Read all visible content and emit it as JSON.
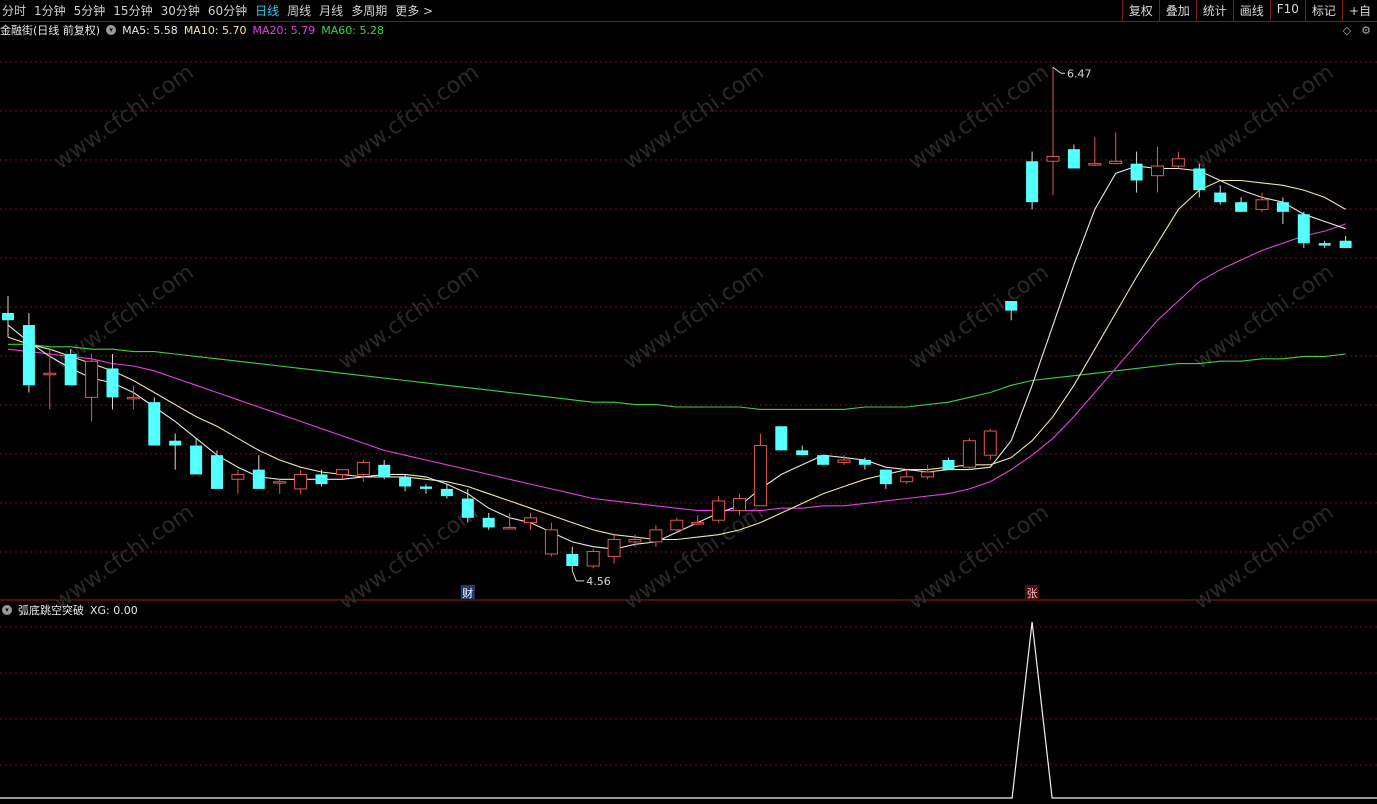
{
  "toolbar": {
    "periods": [
      "分时",
      "1分钟",
      "5分钟",
      "15分钟",
      "30分钟",
      "60分钟",
      "日线",
      "周线",
      "月线",
      "多周期",
      "更多 >"
    ],
    "active_period": "日线",
    "right_tools": [
      "复权",
      "叠加",
      "统计",
      "画线",
      "F10",
      "标记",
      "+自"
    ]
  },
  "stock": {
    "title": "金融街(日线 前复权)",
    "ma": [
      {
        "label": "MA5: 5.58",
        "color": "#e8e8e8"
      },
      {
        "label": "MA10: 5.70",
        "color": "#f0e6a0"
      },
      {
        "label": "MA20: 5.79",
        "color": "#e040e0"
      },
      {
        "label": "MA60: 5.28",
        "color": "#40d040"
      }
    ]
  },
  "indicator": {
    "title": "弧底跳空突破",
    "value": "XG: 0.00"
  },
  "annotations": {
    "high": "6.47",
    "low": "4.56",
    "marker1": "财",
    "marker2": "张"
  },
  "corner": {
    "diamond": "◇",
    "gear": "⚙"
  },
  "watermark": "www.cfchi.com",
  "colors": {
    "up": "#e05a4a",
    "down": "#54ffff",
    "ma5": "#e8e8e8",
    "ma10": "#f0e6a0",
    "ma20": "#e040e0",
    "ma60": "#40d040",
    "grid": "#6a1818"
  },
  "chart_data": {
    "type": "candlestick",
    "price_range": [
      4.4,
      6.55
    ],
    "candles": [
      {
        "o": 5.45,
        "h": 5.52,
        "l": 5.35,
        "c": 5.42
      },
      {
        "o": 5.4,
        "h": 5.45,
        "l": 5.12,
        "c": 5.15
      },
      {
        "o": 5.2,
        "h": 5.3,
        "l": 5.05,
        "c": 5.2
      },
      {
        "o": 5.28,
        "h": 5.3,
        "l": 5.15,
        "c": 5.15
      },
      {
        "o": 5.1,
        "h": 5.28,
        "l": 5.0,
        "c": 5.25
      },
      {
        "o": 5.22,
        "h": 5.28,
        "l": 5.05,
        "c": 5.1
      },
      {
        "o": 5.1,
        "h": 5.15,
        "l": 5.05,
        "c": 5.1
      },
      {
        "o": 5.08,
        "h": 5.1,
        "l": 4.9,
        "c": 4.9
      },
      {
        "o": 4.92,
        "h": 4.95,
        "l": 4.8,
        "c": 4.9
      },
      {
        "o": 4.9,
        "h": 4.93,
        "l": 4.78,
        "c": 4.78
      },
      {
        "o": 4.86,
        "h": 4.88,
        "l": 4.72,
        "c": 4.72
      },
      {
        "o": 4.76,
        "h": 4.8,
        "l": 4.7,
        "c": 4.78
      },
      {
        "o": 4.8,
        "h": 4.86,
        "l": 4.72,
        "c": 4.72
      },
      {
        "o": 4.75,
        "h": 4.76,
        "l": 4.7,
        "c": 4.75
      },
      {
        "o": 4.72,
        "h": 4.8,
        "l": 4.7,
        "c": 4.78
      },
      {
        "o": 4.78,
        "h": 4.8,
        "l": 4.73,
        "c": 4.74
      },
      {
        "o": 4.78,
        "h": 4.8,
        "l": 4.76,
        "c": 4.8
      },
      {
        "o": 4.78,
        "h": 4.84,
        "l": 4.75,
        "c": 4.83
      },
      {
        "o": 4.82,
        "h": 4.84,
        "l": 4.76,
        "c": 4.77
      },
      {
        "o": 4.77,
        "h": 4.78,
        "l": 4.71,
        "c": 4.73
      },
      {
        "o": 4.73,
        "h": 4.74,
        "l": 4.7,
        "c": 4.72
      },
      {
        "o": 4.72,
        "h": 4.74,
        "l": 4.68,
        "c": 4.69
      },
      {
        "o": 4.68,
        "h": 4.72,
        "l": 4.58,
        "c": 4.6
      },
      {
        "o": 4.6,
        "h": 4.62,
        "l": 4.55,
        "c": 4.56
      },
      {
        "o": 4.56,
        "h": 4.62,
        "l": 4.56,
        "c": 4.56
      },
      {
        "o": 4.58,
        "h": 4.62,
        "l": 4.55,
        "c": 4.6
      },
      {
        "o": 4.45,
        "h": 4.58,
        "l": 4.44,
        "c": 4.55
      },
      {
        "o": 4.45,
        "h": 4.48,
        "l": 4.38,
        "c": 4.4
      },
      {
        "o": 4.4,
        "h": 4.47,
        "l": 4.39,
        "c": 4.46
      },
      {
        "o": 4.44,
        "h": 4.53,
        "l": 4.41,
        "c": 4.51
      },
      {
        "o": 4.5,
        "h": 4.53,
        "l": 4.48,
        "c": 4.51
      },
      {
        "o": 4.5,
        "h": 4.57,
        "l": 4.48,
        "c": 4.55
      },
      {
        "o": 4.55,
        "h": 4.6,
        "l": 4.54,
        "c": 4.59
      },
      {
        "o": 4.58,
        "h": 4.61,
        "l": 4.57,
        "c": 4.58
      },
      {
        "o": 4.59,
        "h": 4.69,
        "l": 4.58,
        "c": 4.67
      },
      {
        "o": 4.63,
        "h": 4.7,
        "l": 4.61,
        "c": 4.68
      },
      {
        "o": 4.65,
        "h": 4.95,
        "l": 4.65,
        "c": 4.9
      },
      {
        "o": 4.98,
        "h": 4.98,
        "l": 4.88,
        "c": 4.88
      },
      {
        "o": 4.88,
        "h": 4.9,
        "l": 4.86,
        "c": 4.86
      },
      {
        "o": 4.86,
        "h": 4.86,
        "l": 4.82,
        "c": 4.82
      },
      {
        "o": 4.83,
        "h": 4.86,
        "l": 4.82,
        "c": 4.84
      },
      {
        "o": 4.84,
        "h": 4.85,
        "l": 4.8,
        "c": 4.82
      },
      {
        "o": 4.8,
        "h": 4.8,
        "l": 4.72,
        "c": 4.74
      },
      {
        "o": 4.75,
        "h": 4.8,
        "l": 4.74,
        "c": 4.77
      },
      {
        "o": 4.77,
        "h": 4.82,
        "l": 4.76,
        "c": 4.79
      },
      {
        "o": 4.84,
        "h": 4.85,
        "l": 4.8,
        "c": 4.8
      },
      {
        "o": 4.81,
        "h": 4.93,
        "l": 4.8,
        "c": 4.92
      },
      {
        "o": 4.86,
        "h": 4.97,
        "l": 4.84,
        "c": 4.96
      },
      {
        "o": 5.5,
        "h": 5.5,
        "l": 5.42,
        "c": 5.46
      },
      {
        "o": 6.08,
        "h": 6.12,
        "l": 5.88,
        "c": 5.91
      },
      {
        "o": 6.08,
        "h": 6.47,
        "l": 5.94,
        "c": 6.1
      },
      {
        "o": 6.13,
        "h": 6.15,
        "l": 6.05,
        "c": 6.05
      },
      {
        "o": 6.07,
        "h": 6.18,
        "l": 6.06,
        "c": 6.07
      },
      {
        "o": 6.07,
        "h": 6.2,
        "l": 6.07,
        "c": 6.08
      },
      {
        "o": 6.07,
        "h": 6.12,
        "l": 5.95,
        "c": 6.0
      },
      {
        "o": 6.02,
        "h": 6.14,
        "l": 5.95,
        "c": 6.06
      },
      {
        "o": 6.06,
        "h": 6.12,
        "l": 6.05,
        "c": 6.09
      },
      {
        "o": 6.05,
        "h": 6.07,
        "l": 5.93,
        "c": 5.96
      },
      {
        "o": 5.95,
        "h": 5.98,
        "l": 5.9,
        "c": 5.91
      },
      {
        "o": 5.91,
        "h": 5.93,
        "l": 5.87,
        "c": 5.87
      },
      {
        "o": 5.88,
        "h": 5.95,
        "l": 5.87,
        "c": 5.92
      },
      {
        "o": 5.91,
        "h": 5.93,
        "l": 5.82,
        "c": 5.87
      },
      {
        "o": 5.86,
        "h": 5.87,
        "l": 5.72,
        "c": 5.74
      },
      {
        "o": 5.74,
        "h": 5.75,
        "l": 5.72,
        "c": 5.73
      },
      {
        "o": 5.75,
        "h": 5.77,
        "l": 5.72,
        "c": 5.72
      }
    ],
    "ma5": [
      5.4,
      5.33,
      5.27,
      5.22,
      5.18,
      5.16,
      5.12,
      5.06,
      5.0,
      4.93,
      4.86,
      4.81,
      4.77,
      4.76,
      4.76,
      4.76,
      4.76,
      4.77,
      4.78,
      4.78,
      4.77,
      4.74,
      4.7,
      4.64,
      4.6,
      4.58,
      4.54,
      4.5,
      4.48,
      4.47,
      4.49,
      4.5,
      4.54,
      4.58,
      4.62,
      4.65,
      4.72,
      4.78,
      4.82,
      4.86,
      4.85,
      4.84,
      4.81,
      4.8,
      4.79,
      4.8,
      4.8,
      4.81,
      4.92,
      5.15,
      5.4,
      5.65,
      5.88,
      6.03,
      6.06,
      6.05,
      6.05,
      6.04,
      6.0,
      5.96,
      5.93,
      5.91,
      5.86,
      5.83,
      5.8
    ],
    "ma10": [
      5.35,
      5.32,
      5.3,
      5.27,
      5.24,
      5.21,
      5.17,
      5.12,
      5.07,
      5.02,
      4.98,
      4.93,
      4.88,
      4.84,
      4.81,
      4.79,
      4.78,
      4.77,
      4.77,
      4.77,
      4.76,
      4.75,
      4.73,
      4.7,
      4.67,
      4.64,
      4.61,
      4.58,
      4.55,
      4.53,
      4.52,
      4.51,
      4.51,
      4.52,
      4.53,
      4.55,
      4.58,
      4.62,
      4.66,
      4.7,
      4.73,
      4.76,
      4.78,
      4.8,
      4.8,
      4.81,
      4.82,
      4.82,
      4.85,
      4.92,
      5.02,
      5.15,
      5.3,
      5.45,
      5.6,
      5.74,
      5.88,
      5.96,
      6.0,
      6.0,
      5.99,
      5.98,
      5.96,
      5.93,
      5.88
    ],
    "ma20": [
      5.3,
      5.29,
      5.28,
      5.27,
      5.26,
      5.24,
      5.23,
      5.21,
      5.18,
      5.15,
      5.12,
      5.09,
      5.06,
      5.03,
      5.0,
      4.97,
      4.94,
      4.91,
      4.88,
      4.86,
      4.84,
      4.82,
      4.8,
      4.78,
      4.76,
      4.74,
      4.72,
      4.7,
      4.68,
      4.67,
      4.66,
      4.65,
      4.64,
      4.63,
      4.63,
      4.63,
      4.63,
      4.64,
      4.64,
      4.65,
      4.65,
      4.66,
      4.67,
      4.68,
      4.69,
      4.7,
      4.72,
      4.75,
      4.8,
      4.86,
      4.93,
      5.02,
      5.12,
      5.22,
      5.32,
      5.42,
      5.5,
      5.58,
      5.63,
      5.67,
      5.71,
      5.74,
      5.77,
      5.79,
      5.82
    ],
    "ma60": [
      5.32,
      5.32,
      5.31,
      5.31,
      5.3,
      5.3,
      5.29,
      5.29,
      5.28,
      5.27,
      5.26,
      5.25,
      5.24,
      5.23,
      5.22,
      5.21,
      5.2,
      5.19,
      5.18,
      5.17,
      5.16,
      5.15,
      5.14,
      5.13,
      5.12,
      5.11,
      5.1,
      5.09,
      5.08,
      5.08,
      5.07,
      5.07,
      5.06,
      5.06,
      5.06,
      5.06,
      5.05,
      5.05,
      5.05,
      5.05,
      5.05,
      5.06,
      5.06,
      5.06,
      5.07,
      5.08,
      5.1,
      5.12,
      5.15,
      5.17,
      5.18,
      5.19,
      5.2,
      5.21,
      5.22,
      5.23,
      5.24,
      5.24,
      5.25,
      5.25,
      5.26,
      5.26,
      5.27,
      5.27,
      5.28
    ],
    "xg_signal_index": 49,
    "xg_value": 0.0
  }
}
